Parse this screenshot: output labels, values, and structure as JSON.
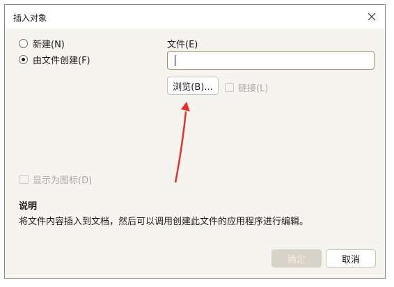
{
  "window": {
    "title": "插入对象"
  },
  "options": {
    "create_new_label": "新建(N)",
    "create_from_file_label": "由文件创建(F)",
    "selected": "create_from_file"
  },
  "file": {
    "label": "文件(E)",
    "value": "",
    "browse_label": "浏览(B)...",
    "link_label": "链接(L)",
    "link_checked": false
  },
  "display_as_icon": {
    "label": "显示为图标(D)",
    "checked": false
  },
  "description": {
    "title": "说明",
    "text": "将文件内容插入到文档，然后可以调用创建此文件的应用程序进行编辑。"
  },
  "buttons": {
    "ok_label": "确定",
    "cancel_label": "取消"
  },
  "colors": {
    "annotation_arrow": "#e8302a",
    "dialog_bg": "#f6f4ef"
  }
}
